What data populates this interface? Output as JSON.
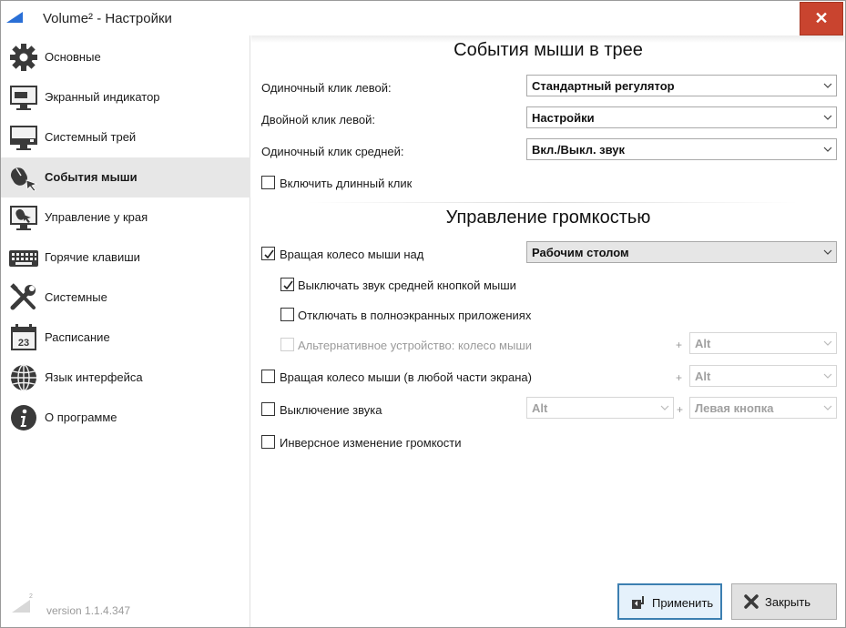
{
  "window": {
    "title": "Volume² - Настройки",
    "close_label": "✕"
  },
  "sidebar": {
    "items": [
      {
        "label": "Основные",
        "icon": "gear-icon"
      },
      {
        "label": "Экранный индикатор",
        "icon": "monitor-indicator-icon"
      },
      {
        "label": "Системный трей",
        "icon": "system-tray-icon"
      },
      {
        "label": "События мыши",
        "icon": "mouse-events-icon",
        "active": true
      },
      {
        "label": "Управление у края",
        "icon": "edge-control-icon"
      },
      {
        "label": "Горячие клавиши",
        "icon": "keyboard-icon"
      },
      {
        "label": "Системные",
        "icon": "tools-icon"
      },
      {
        "label": "Расписание",
        "icon": "calendar-icon",
        "calendar_day": "23"
      },
      {
        "label": "Язык интерфейса",
        "icon": "globe-icon"
      },
      {
        "label": "О программе",
        "icon": "info-icon"
      }
    ],
    "version": "version 1.1.4.347",
    "version_logo_text": "2"
  },
  "main": {
    "tray_section": {
      "title": "События мыши в трее",
      "rows": [
        {
          "label": "Одиночный клик левой:",
          "value": "Стандартный регулятор"
        },
        {
          "label": "Двойной клик левой:",
          "value": "Настройки"
        },
        {
          "label": "Одиночный клик средней:",
          "value": "Вкл./Выкл. звук"
        }
      ],
      "long_click": {
        "label": "Включить длинный клик",
        "checked": false
      }
    },
    "volume_section": {
      "title": "Управление громкостью",
      "wheel_over": {
        "label": "Вращая колесо мыши над",
        "checked": true,
        "value": "Рабочим столом"
      },
      "mute_middle": {
        "label": "Выключать звук средней кнопкой мыши",
        "checked": true
      },
      "fullscreen_off": {
        "label": "Отключать в полноэкранных приложениях",
        "checked": false
      },
      "alt_device": {
        "label": "Альтернативное устройство: колесо мыши",
        "checked": false,
        "disabled": true,
        "plus": "+",
        "modifier": "Alt"
      },
      "wheel_anywhere": {
        "label": "Вращая колесо мыши (в любой части экрана)",
        "checked": false,
        "plus": "+",
        "modifier": "Alt"
      },
      "mute": {
        "label": "Выключение звука",
        "checked": false,
        "modifier": "Alt",
        "plus": "+",
        "button": "Левая кнопка"
      },
      "inverse": {
        "label": "Инверсное изменение громкости",
        "checked": false
      }
    }
  },
  "buttons": {
    "apply": "Применить",
    "close": "Закрыть"
  }
}
